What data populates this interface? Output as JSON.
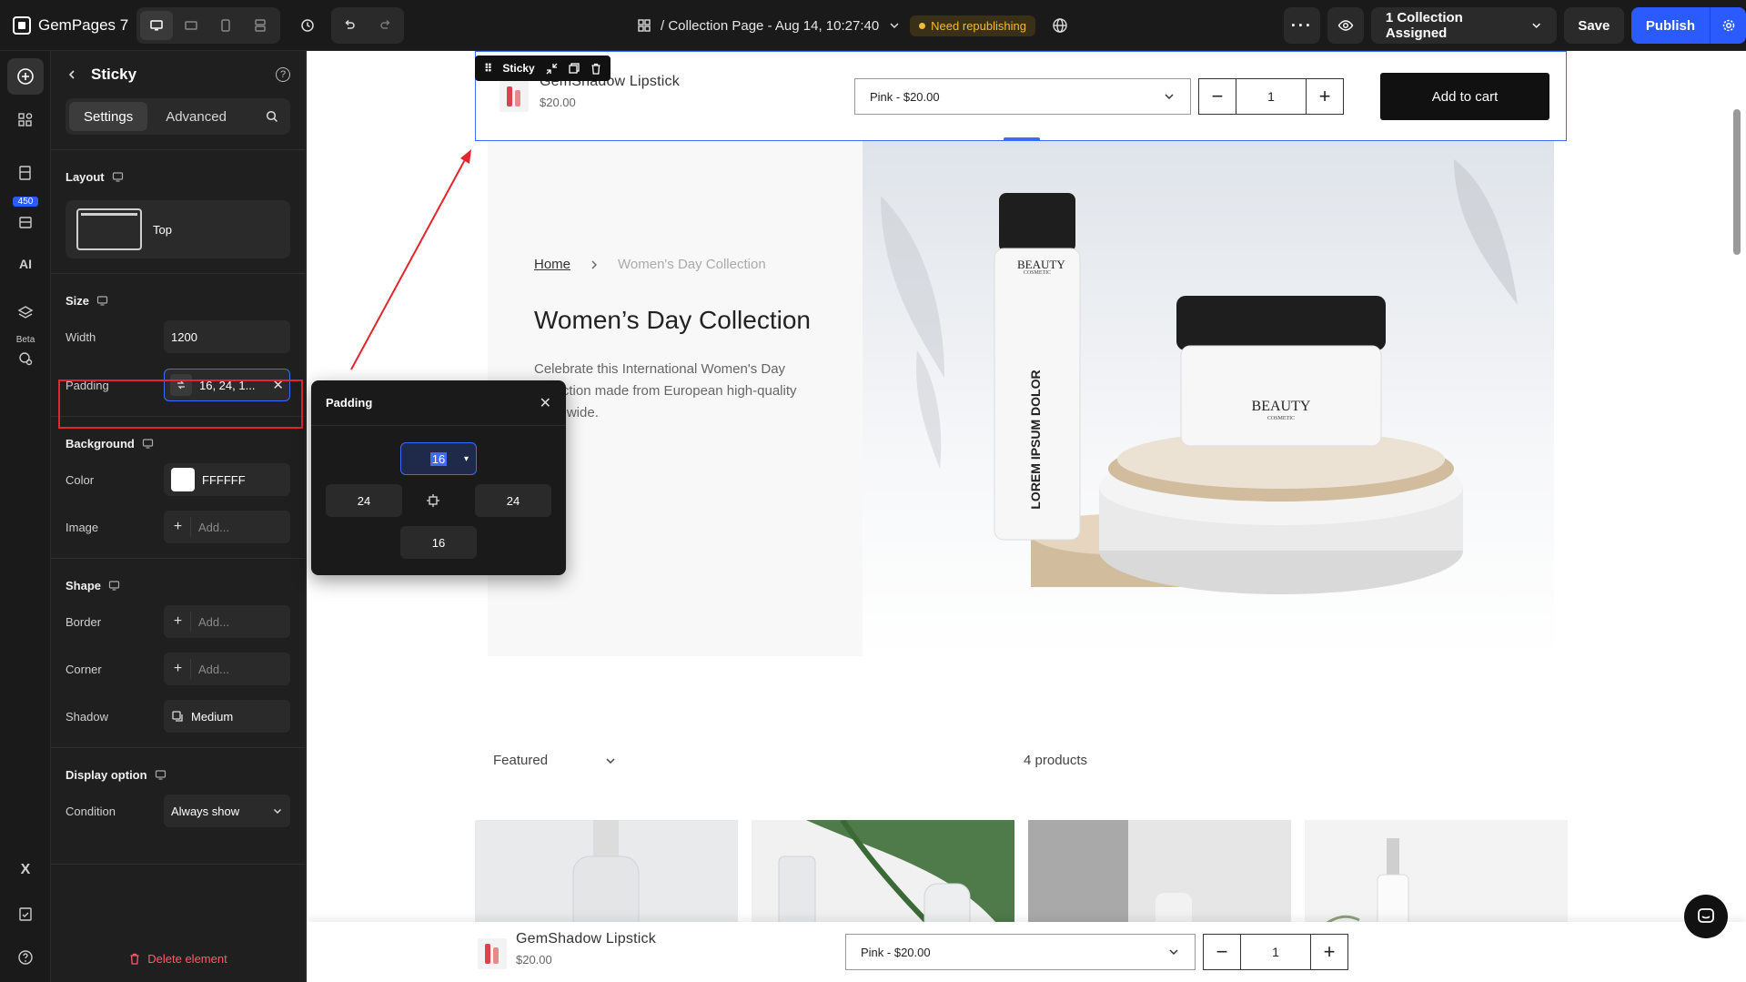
{
  "app": {
    "name": "GemPages 7"
  },
  "topbar": {
    "page_title": "/ Collection Page - Aug 14, 10:27:40",
    "status_badge": "Need republishing",
    "assigned": "1 Collection Assigned",
    "save": "Save",
    "publish": "Publish"
  },
  "rail": {
    "counter": "450",
    "ai": "AI",
    "beta": "Beta"
  },
  "panel": {
    "title": "Sticky",
    "tabs": [
      "Settings",
      "Advanced"
    ],
    "layout": {
      "title": "Layout",
      "value": "Top"
    },
    "size": {
      "title": "Size",
      "width_label": "Width",
      "width_value": "1200",
      "padding_label": "Padding",
      "padding_value": "16, 24, 1..."
    },
    "background": {
      "title": "Background",
      "color_label": "Color",
      "color_value": "FFFFFF",
      "image_label": "Image",
      "image_placeholder": "Add..."
    },
    "shape": {
      "title": "Shape",
      "border_label": "Border",
      "border_placeholder": "Add...",
      "corner_label": "Corner",
      "corner_placeholder": "Add...",
      "shadow_label": "Shadow",
      "shadow_value": "Medium"
    },
    "display": {
      "title": "Display option",
      "condition_label": "Condition",
      "condition_value": "Always show"
    },
    "delete": "Delete element"
  },
  "popover": {
    "title": "Padding",
    "top": "16",
    "left": "24",
    "right": "24",
    "bottom": "16"
  },
  "canvas": {
    "sticky_tag": "Sticky",
    "product_name": "GemShadow Lipstick",
    "product_price": "$20.00",
    "variant": "Pink - $20.00",
    "qty": "1",
    "add_to_cart": "Add to cart",
    "breadcrumb_home": "Home",
    "breadcrumb_current": "Women's Day Collection",
    "hero_title": "Women’s Day Collection",
    "hero_desc": "Celebrate this International Women's Day collection made from European high-quality worldwide.",
    "beauty_brand": "BEAUTY",
    "beauty_sub": "COSMETIC",
    "bottle_text": "LOREM IPSUM DOLOR",
    "sort": "Featured",
    "count": "4 products"
  },
  "colors": {
    "accent": "#2b5bff",
    "highlight": "#e3262d",
    "badge": "#f2b93b"
  }
}
